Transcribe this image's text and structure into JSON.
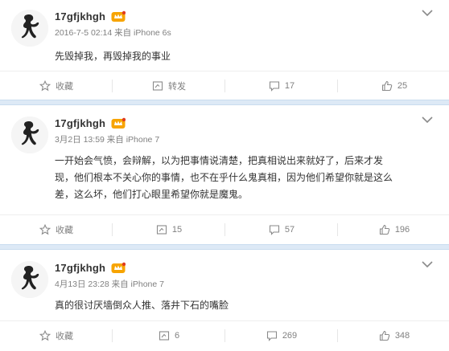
{
  "colors": {
    "separator_band": "#dde9f6",
    "meta_text": "#808080",
    "body_text": "#333333",
    "badge_orange": "#f7a400"
  },
  "posts": [
    {
      "username": "17gfjkhgh",
      "meta": "2016-7-5 02:14 来自 iPhone 6s",
      "content_lines": [
        "先毁掉我，再毁掉我的事业"
      ],
      "actions": {
        "collect_label": "收藏",
        "repost_label": "转发",
        "comment_count": "17",
        "like_count": "25"
      }
    },
    {
      "username": "17gfjkhgh",
      "meta": "3月2日 13:59 来自 iPhone 7",
      "content_lines": [
        "一开始会气愤，会辩解，以为把事情说清楚，把真相说出来就好了，后来才发",
        "现，他们根本不关心你的事情，也不在乎什么鬼真相，因为他们希望你就是这么",
        "差，这么坏，他们打心眼里希望你就是魔鬼。"
      ],
      "actions": {
        "collect_label": "收藏",
        "repost_count": "15",
        "comment_count": "57",
        "like_count": "196"
      }
    },
    {
      "username": "17gfjkhgh",
      "meta": "4月13日 23:28 来自 iPhone 7",
      "content_lines": [
        "真的很讨厌墙倒众人推、落井下石的嘴脸"
      ],
      "actions": {
        "collect_label": "收藏",
        "repost_count": "6",
        "comment_count": "269",
        "like_count": "348"
      }
    }
  ],
  "icons": {
    "avatar": "silhouette-avatar",
    "badge": "vip-crown-badge-icon",
    "menu": "chevron-down-icon",
    "collect": "star-outline-icon",
    "repost": "repost-icon",
    "comment": "comment-bubble-icon",
    "like": "thumbs-up-icon"
  }
}
